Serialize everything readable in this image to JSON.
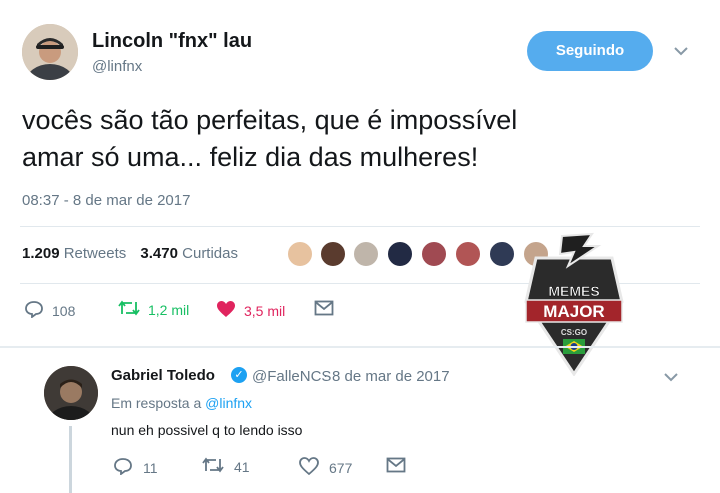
{
  "tweet": {
    "display_name": "Lincoln \"fnx\" lau",
    "handle": "@linfnx",
    "follow_label": "Seguindo",
    "text_line1": "vocês são tão perfeitas, que é impossível",
    "text_line2": "amar só uma... feliz dia das mulheres!",
    "timestamp": "08:37 - 8 de mar de 2017",
    "retweets_count": "1.209",
    "retweets_label": "Retweets",
    "likes_count": "3.470",
    "likes_label": "Curtidas",
    "replies": "108",
    "retweets_short": "1,2 mil",
    "likes_short": "3,5 mil"
  },
  "reply": {
    "display_name": "Gabriel Toledo",
    "handle": "@FalleNCS",
    "separator": "·",
    "date": "8 de mar de 2017",
    "in_reply_prefix": "Em resposta a",
    "in_reply_handle": "@linfnx",
    "text": "nun eh possivel q to lendo isso",
    "replies": "11",
    "retweets": "41",
    "likes": "677"
  },
  "badge": {
    "line1": "MEMES",
    "line2": "MAJOR",
    "line3": "CS:GO"
  },
  "colors": {
    "accent": "#55acee",
    "retweet_green": "#17bf63",
    "like_red": "#e0245e",
    "muted": "#657786",
    "badge_dark": "#2b2b2b",
    "badge_red": "#a3252b"
  },
  "icons": {
    "reply": "reply-icon",
    "retweet": "retweet-icon",
    "like": "heart-icon",
    "dm": "envelope-icon",
    "more": "chevron-down-icon",
    "verified": "verified-badge-icon"
  }
}
